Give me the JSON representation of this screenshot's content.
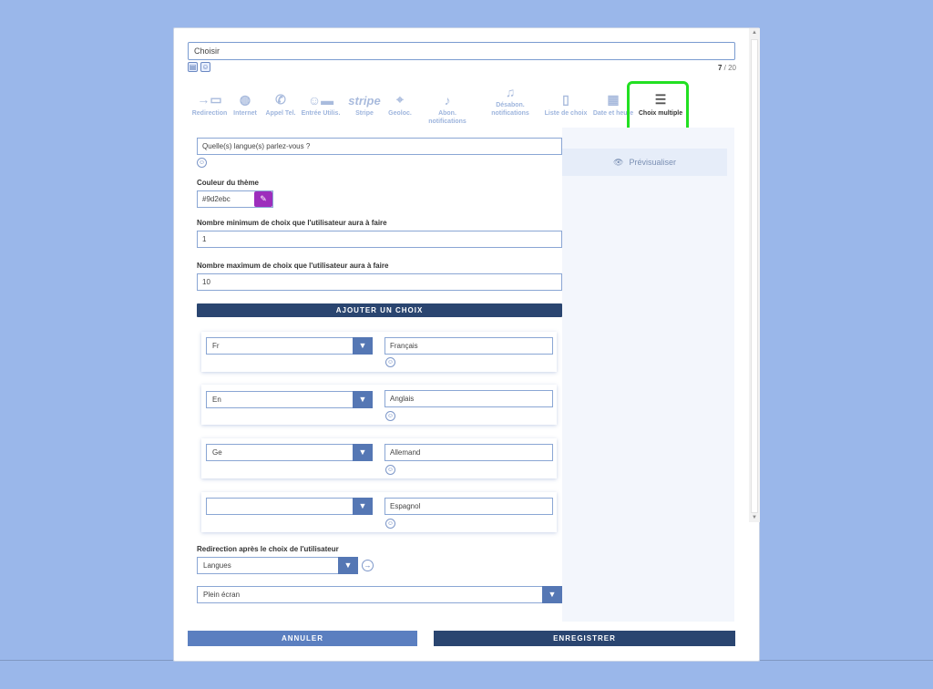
{
  "header": {
    "title_value": "Choisir",
    "counter_current": "7",
    "counter_total": "/ 20"
  },
  "toolbar": {
    "items": [
      {
        "label": "Redirection",
        "icon": "arrow-redirect-icon"
      },
      {
        "label": "Internet",
        "icon": "globe-icon"
      },
      {
        "label": "Appel Tel.",
        "icon": "phone-icon"
      },
      {
        "label": "Entrée Utilis.",
        "icon": "user-chat-icon"
      },
      {
        "label": "Stripe",
        "icon": "stripe-logo",
        "word": "stripe"
      },
      {
        "label": "Geoloc.",
        "icon": "location-pin-icon"
      },
      {
        "label": "Abon. notifications",
        "icon": "bell-plus-icon"
      },
      {
        "label": "Désabon. notifications",
        "icon": "bell-off-icon"
      },
      {
        "label": "Liste de choix",
        "icon": "list-icon"
      },
      {
        "label": "Date et heure",
        "icon": "calendar-icon"
      },
      {
        "label": "Choix multiple",
        "icon": "checklist-icon"
      }
    ]
  },
  "preview": {
    "label": "Prévisualiser"
  },
  "form": {
    "question_value": "Quelle(s) langue(s) parlez-vous ?",
    "theme_color_label": "Couleur du thème",
    "theme_color_value": "#9d2ebc",
    "min_label": "Nombre minimum de choix que l'utilisateur aura à faire",
    "min_value": "1",
    "max_label": "Nombre maximum de choix que l'utilisateur aura à faire",
    "max_value": "10",
    "add_choice_label": "AJOUTER UN CHOIX",
    "choices": [
      {
        "code": "Fr",
        "text": "Français"
      },
      {
        "code": "En",
        "text": "Anglais"
      },
      {
        "code": "Ge",
        "text": "Allemand"
      },
      {
        "code": "",
        "text": "Espagnol"
      }
    ],
    "redirect_label": "Redirection après le choix de l'utilisateur",
    "redirect_value": "Langues",
    "display_value": "Plein écran"
  },
  "footer": {
    "cancel_label": "ANNULER",
    "save_label": "ENREGISTRER"
  },
  "colors": {
    "accent": "#2a4570",
    "secondary": "#5b7fc0",
    "highlight": "#22e022",
    "theme": "#9d2ebc"
  }
}
